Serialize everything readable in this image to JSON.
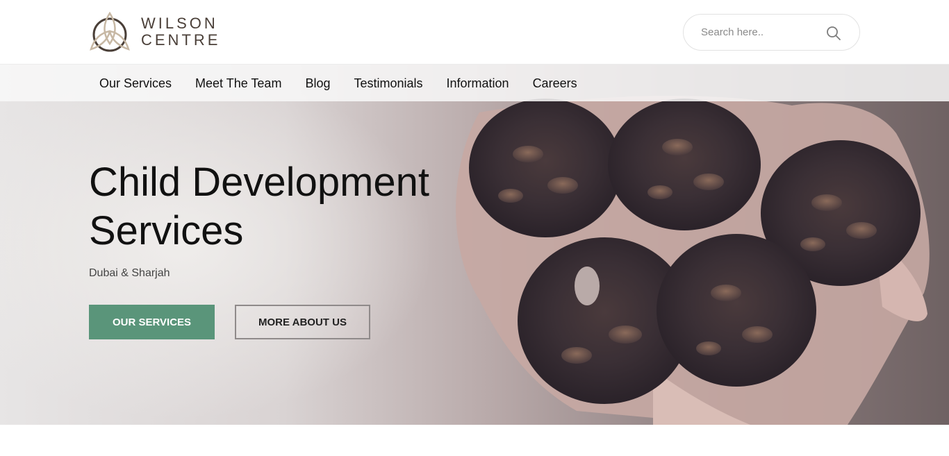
{
  "brand": {
    "line1": "WILSON",
    "line2": "CENTRE",
    "logo_icon": "trinity-knot-icon",
    "color": "#4a3f38"
  },
  "search": {
    "placeholder": "Search here..",
    "icon": "search-icon"
  },
  "nav": {
    "items": [
      "Our Services",
      "Meet The Team",
      "Blog",
      "Testimonials",
      "Information",
      "Careers"
    ]
  },
  "hero": {
    "title_line1": "Child Development",
    "title_line2": "Services",
    "subtitle": "Dubai & Sharjah",
    "primary_button": "OUR SERVICES",
    "secondary_button": "MORE ABOUT US",
    "accent_color": "#5a957a",
    "image_subject": "hands-holding-pine-cones"
  }
}
